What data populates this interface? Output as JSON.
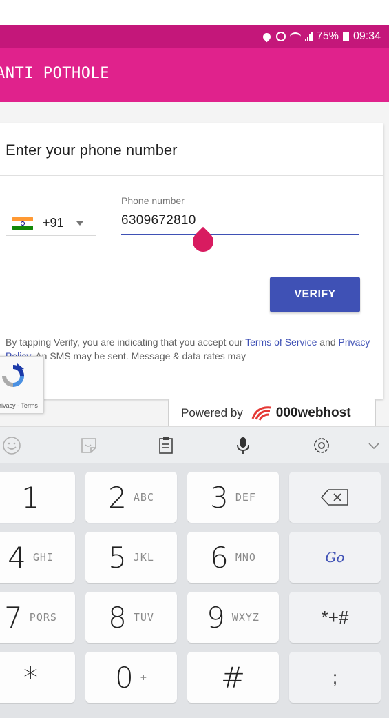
{
  "status_bar": {
    "battery_percent": "75%",
    "time": "09:34",
    "icons": [
      "location-icon",
      "alarm-icon",
      "wifi-icon",
      "signal-icon",
      "battery-icon"
    ]
  },
  "app_bar": {
    "title": "ANTI POTHOLE",
    "color": "#e0228c"
  },
  "card": {
    "title": "Enter your phone number",
    "country_code": "+91",
    "country_flag": "india-flag-icon",
    "phone_label": "Phone number",
    "phone_value": "6309672810",
    "verify_label": "VERIFY",
    "legal": {
      "prefix": "By tapping Verify, you are indicating that you accept our ",
      "terms": "Terms of Service",
      "and": " and ",
      "privacy": "Privacy Policy",
      "suffix": ". An SMS may be sent. Message & data rates may"
    }
  },
  "recaptcha": {
    "text": "Privacy - Terms"
  },
  "powered_by": {
    "text": "Powered by",
    "brand": "000webhost"
  },
  "keyboard": {
    "toolbar_icons": [
      "emoji-icon",
      "sticker-icon",
      "clipboard-icon",
      "microphone-icon",
      "settings-icon",
      "collapse-icon"
    ],
    "rows": [
      [
        {
          "main": "1",
          "sub": ""
        },
        {
          "main": "2",
          "sub": "ABC"
        },
        {
          "main": "3",
          "sub": "DEF"
        },
        {
          "main": "⌫",
          "sub": ""
        }
      ],
      [
        {
          "main": "4",
          "sub": "GHI"
        },
        {
          "main": "5",
          "sub": "JKL"
        },
        {
          "main": "6",
          "sub": "MNO"
        },
        {
          "main": "Go",
          "sub": ""
        }
      ],
      [
        {
          "main": "7",
          "sub": "PQRS"
        },
        {
          "main": "8",
          "sub": "TUV"
        },
        {
          "main": "9",
          "sub": "WXYZ"
        },
        {
          "main": "*+#",
          "sub": ""
        }
      ],
      [
        {
          "main": "*",
          "sub": ""
        },
        {
          "main": "0",
          "sub": "+"
        },
        {
          "main": "#",
          "sub": ""
        },
        {
          "main": ";",
          "sub": ""
        }
      ]
    ]
  }
}
